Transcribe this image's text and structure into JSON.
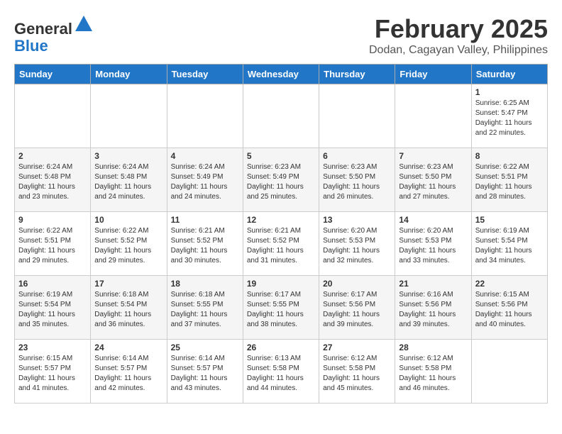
{
  "header": {
    "logo_general": "General",
    "logo_blue": "Blue",
    "main_title": "February 2025",
    "subtitle": "Dodan, Cagayan Valley, Philippines"
  },
  "days_of_week": [
    "Sunday",
    "Monday",
    "Tuesday",
    "Wednesday",
    "Thursday",
    "Friday",
    "Saturday"
  ],
  "weeks": [
    [
      {
        "day": "",
        "info": ""
      },
      {
        "day": "",
        "info": ""
      },
      {
        "day": "",
        "info": ""
      },
      {
        "day": "",
        "info": ""
      },
      {
        "day": "",
        "info": ""
      },
      {
        "day": "",
        "info": ""
      },
      {
        "day": "1",
        "info": "Sunrise: 6:25 AM\nSunset: 5:47 PM\nDaylight: 11 hours and 22 minutes."
      }
    ],
    [
      {
        "day": "2",
        "info": "Sunrise: 6:24 AM\nSunset: 5:48 PM\nDaylight: 11 hours and 23 minutes."
      },
      {
        "day": "3",
        "info": "Sunrise: 6:24 AM\nSunset: 5:48 PM\nDaylight: 11 hours and 24 minutes."
      },
      {
        "day": "4",
        "info": "Sunrise: 6:24 AM\nSunset: 5:49 PM\nDaylight: 11 hours and 24 minutes."
      },
      {
        "day": "5",
        "info": "Sunrise: 6:23 AM\nSunset: 5:49 PM\nDaylight: 11 hours and 25 minutes."
      },
      {
        "day": "6",
        "info": "Sunrise: 6:23 AM\nSunset: 5:50 PM\nDaylight: 11 hours and 26 minutes."
      },
      {
        "day": "7",
        "info": "Sunrise: 6:23 AM\nSunset: 5:50 PM\nDaylight: 11 hours and 27 minutes."
      },
      {
        "day": "8",
        "info": "Sunrise: 6:22 AM\nSunset: 5:51 PM\nDaylight: 11 hours and 28 minutes."
      }
    ],
    [
      {
        "day": "9",
        "info": "Sunrise: 6:22 AM\nSunset: 5:51 PM\nDaylight: 11 hours and 29 minutes."
      },
      {
        "day": "10",
        "info": "Sunrise: 6:22 AM\nSunset: 5:52 PM\nDaylight: 11 hours and 29 minutes."
      },
      {
        "day": "11",
        "info": "Sunrise: 6:21 AM\nSunset: 5:52 PM\nDaylight: 11 hours and 30 minutes."
      },
      {
        "day": "12",
        "info": "Sunrise: 6:21 AM\nSunset: 5:52 PM\nDaylight: 11 hours and 31 minutes."
      },
      {
        "day": "13",
        "info": "Sunrise: 6:20 AM\nSunset: 5:53 PM\nDaylight: 11 hours and 32 minutes."
      },
      {
        "day": "14",
        "info": "Sunrise: 6:20 AM\nSunset: 5:53 PM\nDaylight: 11 hours and 33 minutes."
      },
      {
        "day": "15",
        "info": "Sunrise: 6:19 AM\nSunset: 5:54 PM\nDaylight: 11 hours and 34 minutes."
      }
    ],
    [
      {
        "day": "16",
        "info": "Sunrise: 6:19 AM\nSunset: 5:54 PM\nDaylight: 11 hours and 35 minutes."
      },
      {
        "day": "17",
        "info": "Sunrise: 6:18 AM\nSunset: 5:54 PM\nDaylight: 11 hours and 36 minutes."
      },
      {
        "day": "18",
        "info": "Sunrise: 6:18 AM\nSunset: 5:55 PM\nDaylight: 11 hours and 37 minutes."
      },
      {
        "day": "19",
        "info": "Sunrise: 6:17 AM\nSunset: 5:55 PM\nDaylight: 11 hours and 38 minutes."
      },
      {
        "day": "20",
        "info": "Sunrise: 6:17 AM\nSunset: 5:56 PM\nDaylight: 11 hours and 39 minutes."
      },
      {
        "day": "21",
        "info": "Sunrise: 6:16 AM\nSunset: 5:56 PM\nDaylight: 11 hours and 39 minutes."
      },
      {
        "day": "22",
        "info": "Sunrise: 6:15 AM\nSunset: 5:56 PM\nDaylight: 11 hours and 40 minutes."
      }
    ],
    [
      {
        "day": "23",
        "info": "Sunrise: 6:15 AM\nSunset: 5:57 PM\nDaylight: 11 hours and 41 minutes."
      },
      {
        "day": "24",
        "info": "Sunrise: 6:14 AM\nSunset: 5:57 PM\nDaylight: 11 hours and 42 minutes."
      },
      {
        "day": "25",
        "info": "Sunrise: 6:14 AM\nSunset: 5:57 PM\nDaylight: 11 hours and 43 minutes."
      },
      {
        "day": "26",
        "info": "Sunrise: 6:13 AM\nSunset: 5:58 PM\nDaylight: 11 hours and 44 minutes."
      },
      {
        "day": "27",
        "info": "Sunrise: 6:12 AM\nSunset: 5:58 PM\nDaylight: 11 hours and 45 minutes."
      },
      {
        "day": "28",
        "info": "Sunrise: 6:12 AM\nSunset: 5:58 PM\nDaylight: 11 hours and 46 minutes."
      },
      {
        "day": "",
        "info": ""
      }
    ]
  ]
}
